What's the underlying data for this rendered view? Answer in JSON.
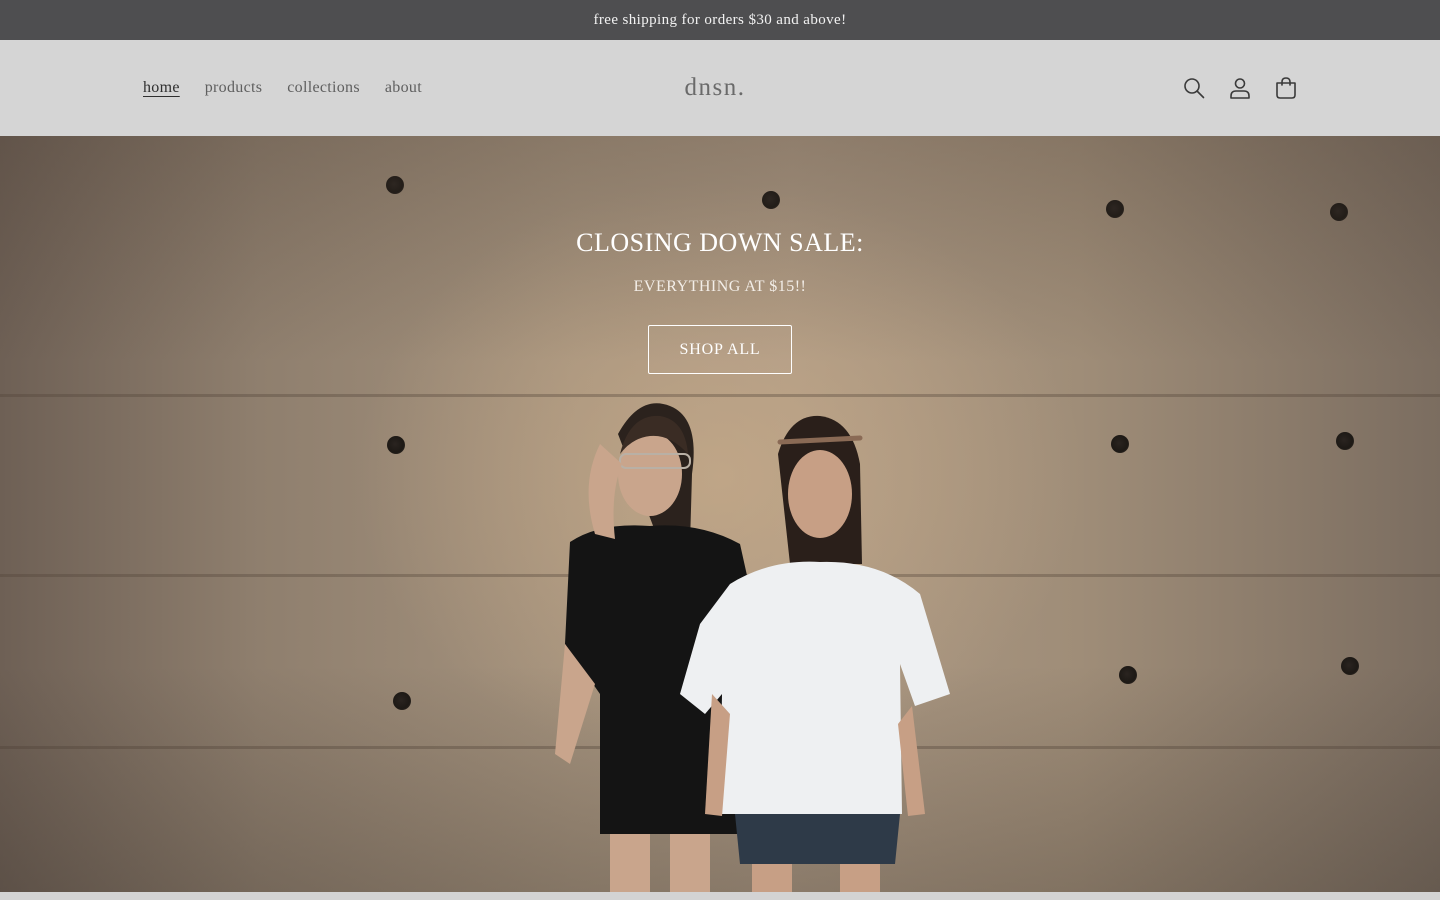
{
  "announcement": {
    "text": "free shipping for orders $30 and above!"
  },
  "header": {
    "logo": "dnsn.",
    "nav": [
      {
        "label": "home",
        "active": true
      },
      {
        "label": "products",
        "active": false
      },
      {
        "label": "collections",
        "active": false
      },
      {
        "label": "about",
        "active": false
      }
    ],
    "icons": [
      "search-icon",
      "account-icon",
      "cart-icon"
    ]
  },
  "hero": {
    "title": "CLOSING DOWN SALE:",
    "subtitle": "EVERYTHING AT $15!!",
    "button_label": "SHOP ALL"
  },
  "colors": {
    "announcement_bg": "#4e4e50",
    "header_bg": "#d5d5d5",
    "text_dark": "#2f2f2f",
    "text_muted": "#5f5f5f",
    "hero_text": "#ffffff"
  }
}
